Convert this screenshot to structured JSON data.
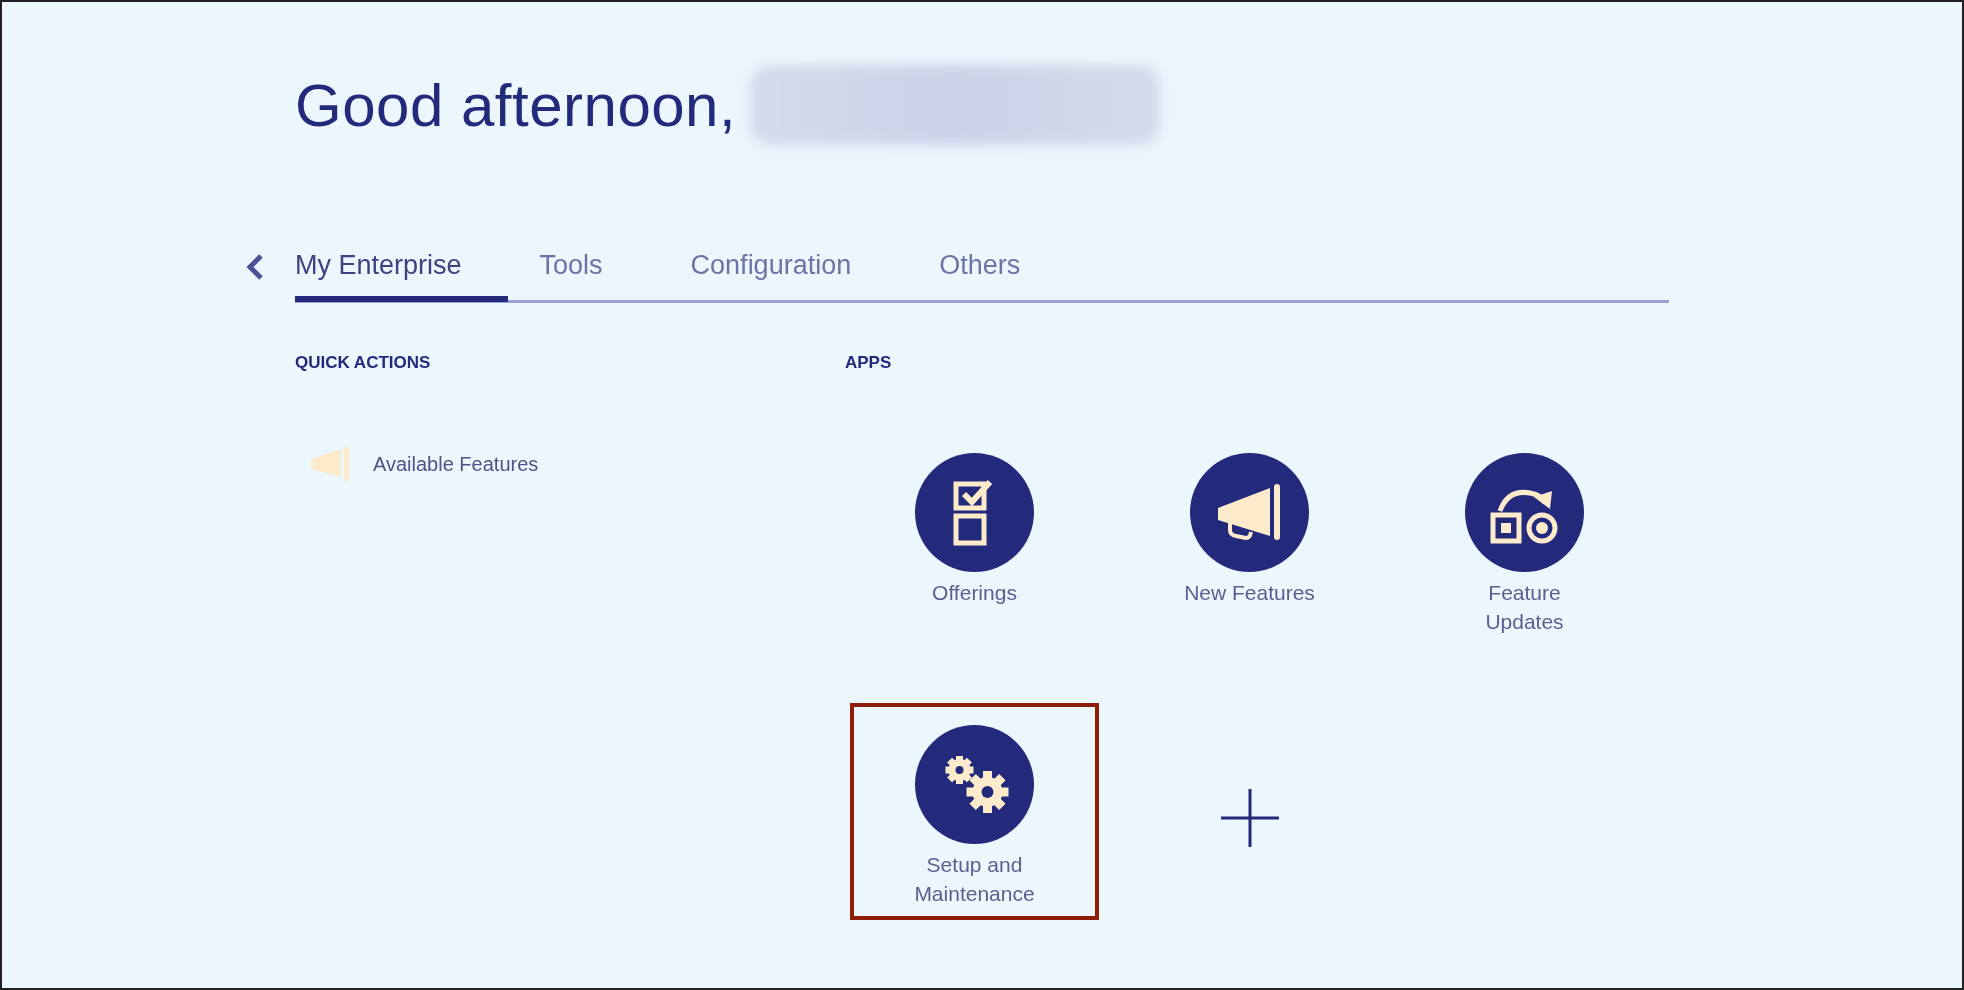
{
  "greeting": {
    "text": "Good afternoon,"
  },
  "tabs": [
    {
      "label": "My Enterprise",
      "selected": true
    },
    {
      "label": "Tools",
      "selected": false
    },
    {
      "label": "Configuration",
      "selected": false
    },
    {
      "label": "Others",
      "selected": false
    }
  ],
  "quick_actions": {
    "heading": "QUICK ACTIONS",
    "items": [
      {
        "label": "Available Features"
      }
    ]
  },
  "apps": {
    "heading": "APPS",
    "items": [
      {
        "kind": "app",
        "label": "Offerings",
        "highlighted": false
      },
      {
        "kind": "app",
        "label": "New Features",
        "highlighted": false
      },
      {
        "kind": "app",
        "label": "Feature Updates",
        "highlighted": false
      },
      {
        "kind": "app",
        "label": "Setup and Maintenance",
        "highlighted": true
      },
      {
        "kind": "add"
      }
    ]
  }
}
